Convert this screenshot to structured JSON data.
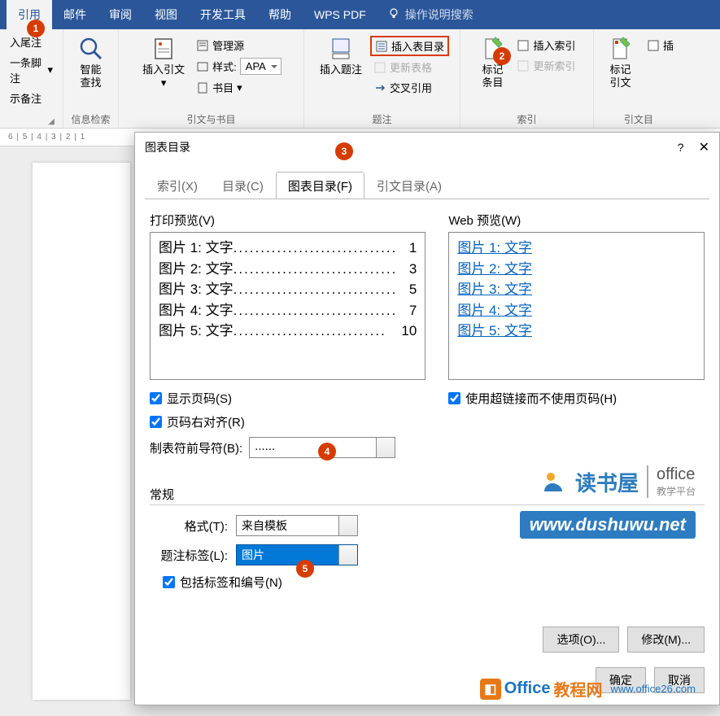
{
  "ribbon": {
    "tabs": [
      "引用",
      "邮件",
      "审阅",
      "视图",
      "开发工具",
      "帮助",
      "WPS PDF"
    ],
    "search_placeholder": "操作说明搜索",
    "groups": {
      "footnotes": {
        "insert_endnote": "入尾注",
        "next_footnote": "一条脚注",
        "show_notes": "示备注",
        "title": ""
      },
      "research": {
        "smart_lookup": "智能\n查找",
        "title": "信息检索"
      },
      "citations": {
        "insert_citation": "插入引文",
        "manage_sources": "管理源",
        "style_label": "样式:",
        "style_value": "APA",
        "bibliography": "书目",
        "title": "引文与书目"
      },
      "captions": {
        "insert_caption": "插入题注",
        "insert_table_of_figures": "插入表目录",
        "update_table": "更新表格",
        "cross_reference": "交叉引用",
        "title": "题注"
      },
      "index": {
        "mark_entry": "标记\n条目",
        "insert_index": "插入索引",
        "update_index": "更新索引",
        "title": "索引"
      },
      "toa": {
        "mark_citation": "标记引文",
        "insert_toa": "插",
        "title": "引文目"
      }
    }
  },
  "ruler": "6 | 5 | 4 | 3 | 2 | 1",
  "dialog": {
    "title": "图表目录",
    "tabs": [
      "索引(X)",
      "目录(C)",
      "图表目录(F)",
      "引文目录(A)"
    ],
    "print_preview_label": "打印预览(V)",
    "web_preview_label": "Web 预览(W)",
    "print_items": [
      {
        "label": "图片 1: 文字",
        "page": "1"
      },
      {
        "label": "图片 2: 文字",
        "page": "3"
      },
      {
        "label": "图片 3: 文字",
        "page": "5"
      },
      {
        "label": "图片 4: 文字",
        "page": "7"
      },
      {
        "label": "图片 5: 文字",
        "page": "10"
      }
    ],
    "web_items": [
      "图片 1: 文字",
      "图片 2: 文字",
      "图片 3: 文字",
      "图片 4: 文字",
      "图片 5: 文字"
    ],
    "show_page_numbers": "显示页码(S)",
    "right_align": "页码右对齐(R)",
    "use_hyperlinks": "使用超链接而不使用页码(H)",
    "tab_leader_label": "制表符前导符(B):",
    "tab_leader_value": "......",
    "general_label": "常规",
    "format_label": "格式(T):",
    "format_value": "来自模板",
    "caption_label_label": "题注标签(L):",
    "caption_label_value": "图片",
    "include_label": "包括标签和编号(N)",
    "options_btn": "选项(O)...",
    "modify_btn": "修改(M)...",
    "ok_btn": "确定",
    "cancel_btn": "取消"
  },
  "badges": {
    "b1": "1",
    "b2": "2",
    "b3": "3",
    "b4": "4",
    "b5": "5"
  },
  "watermark": {
    "dushuwu": "读书屋",
    "office": "office",
    "office_sub": "教学平台",
    "url": "www.dushuwu.net",
    "office_cn": "Office",
    "jiaocheng": "教程网",
    "url2": "www.office26.com"
  }
}
